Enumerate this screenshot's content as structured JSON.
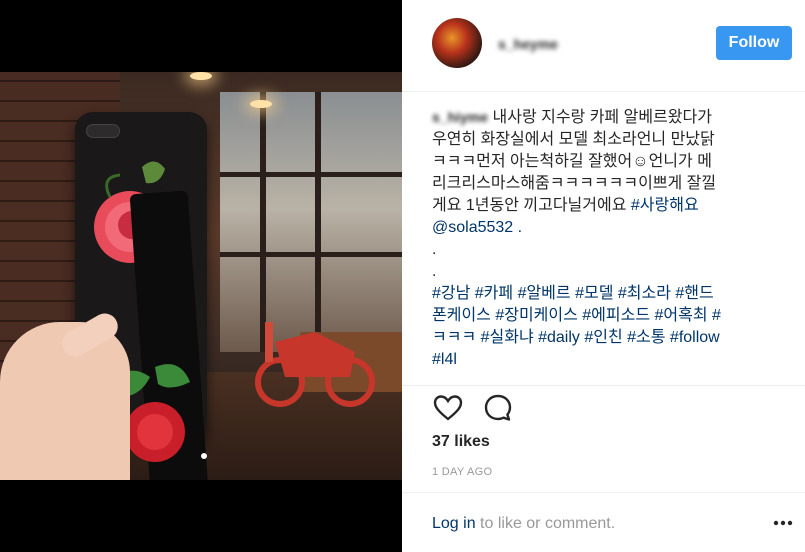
{
  "post": {
    "username": "s_heyme",
    "follow_label": "Follow",
    "caption_username": "s_hiyme",
    "caption_lines": [
      "내사랑 지수랑 카페 알베르왔다가",
      "우연히 화장실에서 모델 최소라언니 만났닭",
      "ㅋㅋㅋ먼저 아는척하길 잘했어☺언니가 메",
      "리크리스마스해줌ㅋㅋㅋㅋㅋㅋ이쁘게 잘낄",
      "게요 1년동안 끼고다닐거에요",
      "@sola5532 .",
      ".",
      ".",
      "#강남 #카페 #알베르 #모델 #최소라 #핸드",
      "폰케이스 #장미케이스 #에피소드 #어혹최 #",
      "ㅋㅋㅋ #실화냐 #daily #인친 #소통 #follow",
      "#l4l"
    ],
    "hashtag_love": "#사랑해요",
    "likes": "37 likes",
    "date": "1 DAY AGO",
    "login_link": "Log in",
    "login_rest": " to like or comment."
  },
  "icons": {
    "like": "heart-icon",
    "comment": "comment-icon",
    "more": "more-options-icon"
  },
  "colors": {
    "follow_button": "#3897f0",
    "link": "#003569",
    "muted": "#999999"
  }
}
